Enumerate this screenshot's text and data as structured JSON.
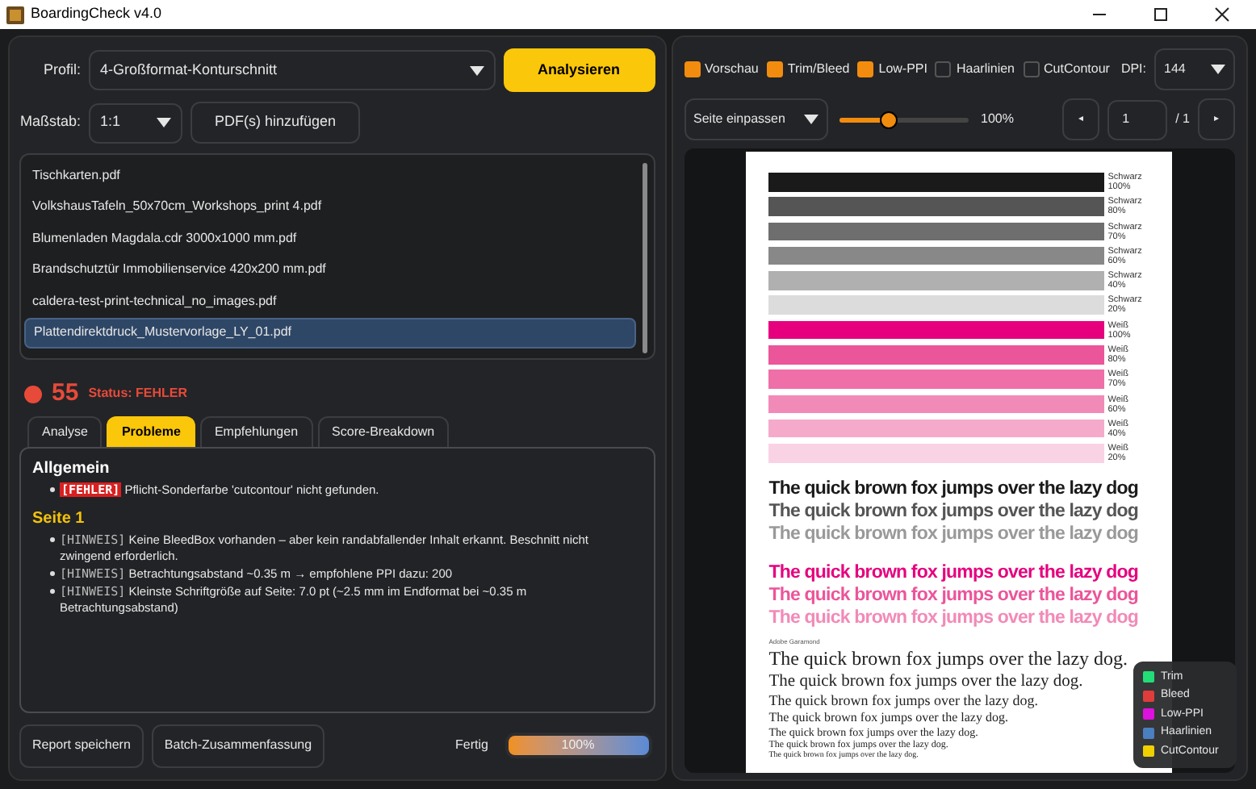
{
  "window": {
    "title": "BoardingCheck v4.0"
  },
  "left": {
    "profile": {
      "label": "Profil:",
      "value": "4-Großformat-Konturschnitt"
    },
    "analyze_button": "Analysieren",
    "scale": {
      "label": "Maßstab:",
      "value": "1:1"
    },
    "add_button": "PDF(s) hinzufügen",
    "files": [
      {
        "name": "Tischkarten.pdf",
        "selected": false
      },
      {
        "name": "VolkshausTafeln_50x70cm_Workshops_print 4.pdf",
        "selected": false
      },
      {
        "name": "Blumenladen Magdala.cdr 3000x1000 mm.pdf",
        "selected": false
      },
      {
        "name": "Brandschutztür Immobilienservice 420x200 mm.pdf",
        "selected": false
      },
      {
        "name": "caldera-test-print-technical_no_images.pdf",
        "selected": false
      },
      {
        "name": "Plattendirektdruck_Mustervorlage_LY_01.pdf",
        "selected": true
      }
    ],
    "score": "55",
    "status": "Status: FEHLER",
    "tabs": [
      {
        "label": "Analyse",
        "selected": false
      },
      {
        "label": "Probleme",
        "selected": true
      },
      {
        "label": "Empfehlungen",
        "selected": false
      },
      {
        "label": "Score-Breakdown",
        "selected": false
      }
    ],
    "sections": [
      {
        "kind": "general",
        "heading": "Allgemein",
        "items": [
          {
            "kind": "error",
            "tag": "[FEHLER]",
            "text": "Pflicht-Sonderfarbe 'cutcontour' nicht gefunden."
          }
        ]
      },
      {
        "kind": "page",
        "heading": "Seite 1",
        "items": [
          {
            "kind": "hint",
            "tag": "[HINWEIS]",
            "text": "Keine BleedBox vorhanden – aber kein randabfallender Inhalt erkannt. Beschnitt nicht zwingend erforderlich."
          },
          {
            "kind": "hint",
            "tag": "[HINWEIS]",
            "text": "Betrachtungsabstand ~0.35 m → empfohlene PPI dazu: 200"
          },
          {
            "kind": "hint",
            "tag": "[HINWEIS]",
            "text": "Kleinste Schriftgröße auf Seite: 7.0 pt (~2.5 mm im Endformat bei ~0.35 m Betrachtungsabstand)"
          }
        ]
      }
    ],
    "save_button": "Report speichern",
    "batch_button": "Batch-Zusammenfassung",
    "progress": {
      "label": "Fertig",
      "level": 1,
      "reading": "100%"
    }
  },
  "right": {
    "toggles": [
      {
        "label": "Vorschau",
        "checked": true
      },
      {
        "label": "Trim/Bleed",
        "checked": true
      },
      {
        "label": "Low-PPI",
        "checked": true
      },
      {
        "label": "Haarlinien",
        "checked": false
      },
      {
        "label": "CutContour",
        "checked": false
      }
    ],
    "dpi": {
      "label": "DPI:",
      "value": "144"
    },
    "fit": {
      "value": "Seite einpassen"
    },
    "zoom": {
      "level": 0.38,
      "reading": "100%"
    },
    "page_nav": {
      "prev": "◂",
      "page": "1",
      "total": "/ 1",
      "next": "▸"
    },
    "preview": {
      "bars": [
        {
          "color": "#1a1a1a",
          "label": "Schwarz 100%"
        },
        {
          "color": "#555555",
          "label": "Schwarz 80%"
        },
        {
          "color": "#6e6e6e",
          "label": "Schwarz 70%"
        },
        {
          "color": "#888888",
          "label": "Schwarz 60%"
        },
        {
          "color": "#b0b0b0",
          "label": "Schwarz 40%"
        },
        {
          "color": "#dcdcdc",
          "label": "Schwarz 20%"
        },
        {
          "color": "#e6007e",
          "label": "Weiß 100%"
        },
        {
          "color": "#eb559a",
          "label": "Weiß 80%"
        },
        {
          "color": "#ef6fa8",
          "label": "Weiß 70%"
        },
        {
          "color": "#f28ab8",
          "label": "Weiß 60%"
        },
        {
          "color": "#f5aacb",
          "label": "Weiß 40%"
        },
        {
          "color": "#f9d3e4",
          "label": "Weiß 20%"
        }
      ],
      "sans_lines": [
        {
          "color": "#1a1a1a",
          "text": "The quick brown fox jumps over the lazy dog"
        },
        {
          "color": "#555555",
          "text": "The quick brown fox jumps over the lazy dog"
        },
        {
          "color": "#999999",
          "text": "The quick brown fox jumps over the lazy dog"
        },
        {
          "color": "#e6007e",
          "text": "The quick brown fox jumps over the lazy dog"
        },
        {
          "color": "#eb559a",
          "text": "The quick brown fox jumps over the lazy dog"
        },
        {
          "color": "#f28ab8",
          "text": "The quick brown fox jumps over the lazy dog"
        }
      ],
      "serif_label": "Adobe Garamond",
      "serif_lines": [
        "The quick brown fox jumps over the lazy dog.",
        "The quick brown fox jumps over the lazy dog.",
        "The quick brown fox jumps over the lazy dog.",
        "The quick brown fox jumps over the lazy dog.",
        "The quick brown fox jumps over the lazy dog.",
        "The quick brown fox jumps over the lazy dog.",
        "The quick brown fox jumps over the lazy dog."
      ]
    },
    "legend": [
      {
        "label": "Trim",
        "color": "#22dd77"
      },
      {
        "label": "Bleed",
        "color": "#e03c3c"
      },
      {
        "label": "Low-PPI",
        "color": "#dd11dd"
      },
      {
        "label": "Haarlinien",
        "color": "#4a7fc0"
      },
      {
        "label": "CutContour",
        "color": "#f0d000"
      }
    ]
  }
}
